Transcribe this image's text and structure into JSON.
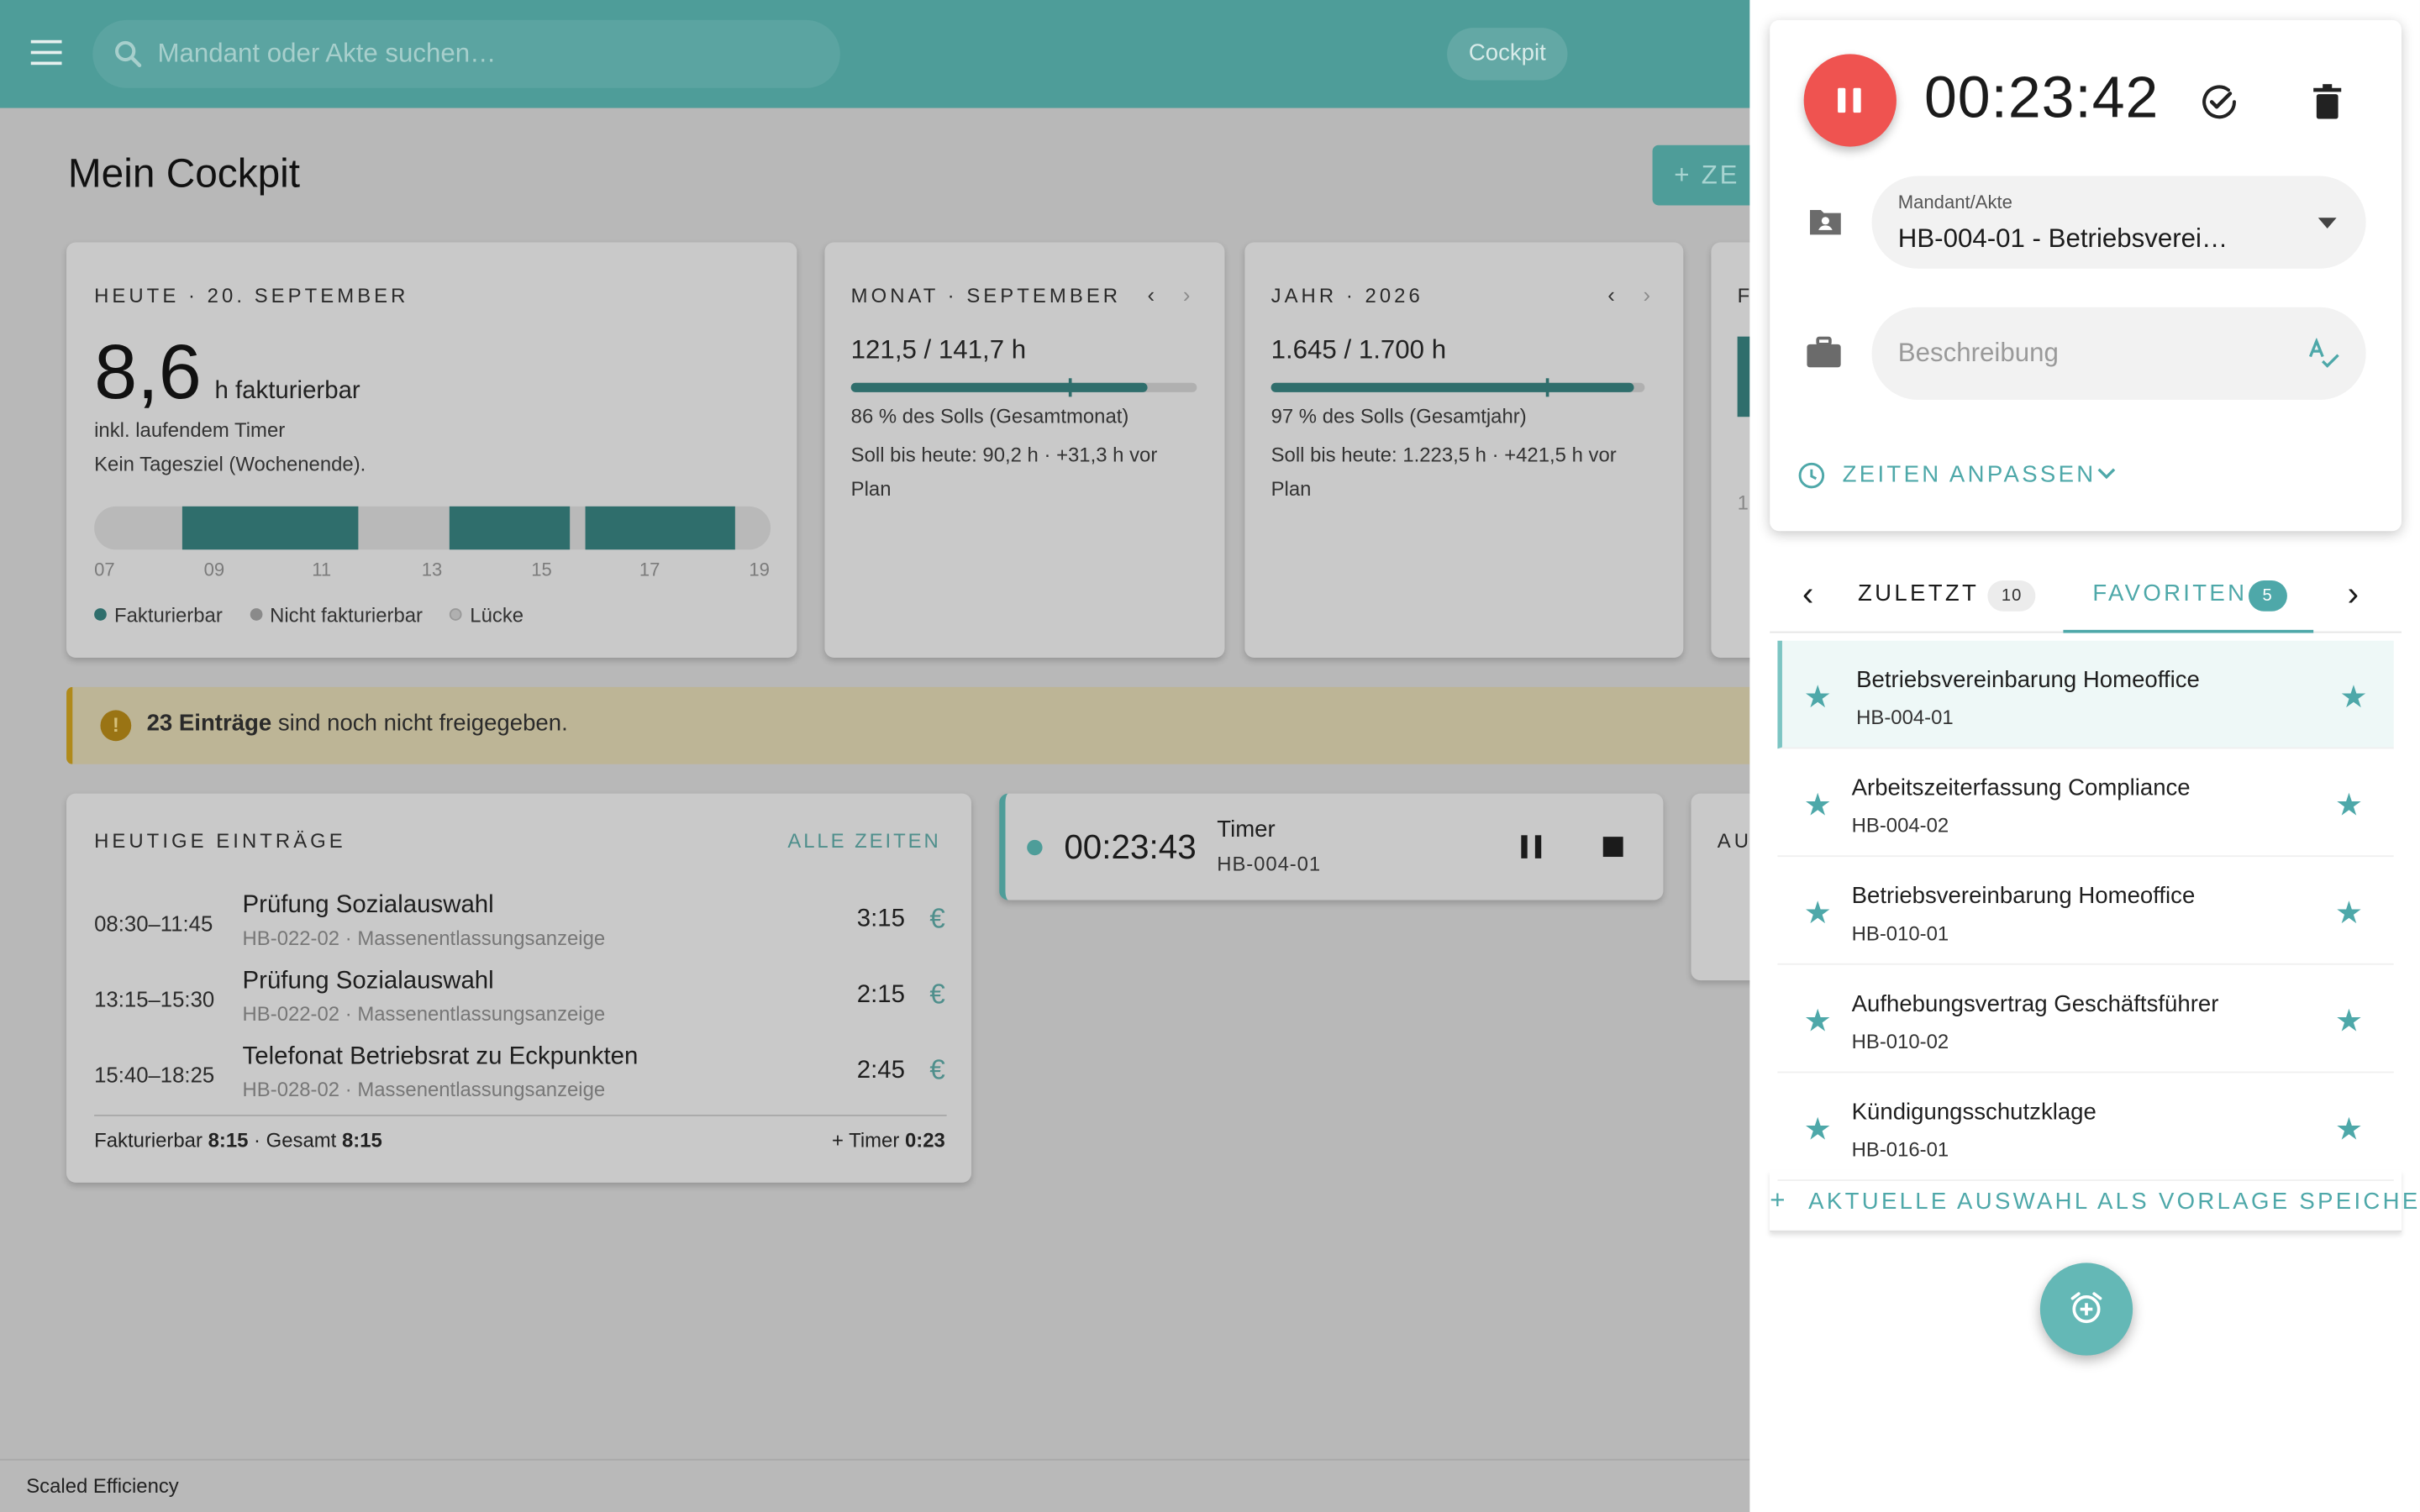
{
  "appbar": {
    "search_placeholder": "Mandant oder Akte suchen…",
    "chip": "Cockpit"
  },
  "page": {
    "title": "Mein Cockpit",
    "add_button": "+ ZE"
  },
  "today": {
    "overline": "HEUTE · 20. SEPTEMBER",
    "value": "8,6",
    "unit": "h fakturierbar",
    "note1": "inkl. laufendem Timer",
    "note2": "Kein Tagesziel (Wochenende).",
    "ticks": [
      "07",
      "09",
      "11",
      "13",
      "15",
      "17",
      "19"
    ],
    "legend": [
      "Fakturierbar",
      "Nicht fakturierbar",
      "Lücke"
    ]
  },
  "month": {
    "overline": "MONAT · SEPTEMBER",
    "value": "121,5 / 141,7 h",
    "percent": "86 % des Solls (Gesamtmonat)",
    "soll": "Soll bis heute: 90,2 h · +31,3 h vor Plan"
  },
  "year": {
    "overline": "JAHR · 2026",
    "value": "1.645 / 1.700 h",
    "percent": "97 % des Solls (Gesamtjahr)",
    "soll": "Soll bis heute: 1.223,5 h · +421,5 h vor Plan"
  },
  "clipped_card": {
    "overline_char": "F",
    "value_char": "1."
  },
  "banner": {
    "bold": "23 Einträge",
    "text": " sind noch nicht freigegeben."
  },
  "entries": {
    "overline": "HEUTIGE EINTRÄGE",
    "all_link": "ALLE ZEITEN",
    "rows": [
      {
        "time": "08:30–11:45",
        "title": "Prüfung Sozialauswahl",
        "sub": "HB-022-02 · Massenentlassungsanzeige",
        "dur": "3:15"
      },
      {
        "time": "13:15–15:30",
        "title": "Prüfung Sozialauswahl",
        "sub": "HB-022-02 · Massenentlassungsanzeige",
        "dur": "2:15"
      },
      {
        "time": "15:40–18:25",
        "title": "Telefonat Betriebsrat zu Eckpunkten",
        "sub": "HB-028-02 · Massenentlassungsanzeige",
        "dur": "2:45"
      }
    ],
    "footer_left_a": "Fakturierbar ",
    "footer_left_b": "8:15",
    "footer_left_c": " · Gesamt ",
    "footer_left_d": "8:15",
    "footer_right_a": "+ Timer ",
    "footer_right_b": "0:23"
  },
  "running": {
    "time": "00:23:43",
    "label": "Timer",
    "case": "HB-004-01"
  },
  "clipped_card2": {
    "overline": "AU"
  },
  "timer_panel": {
    "time": "00:23:42",
    "mandant_label": "Mandant/Akte",
    "mandant_value": "HB-004-01 - Betriebsverei…",
    "description_placeholder": "Beschreibung",
    "adjust": "ZEITEN ANPASSEN"
  },
  "tabs": {
    "recent": "ZULETZT",
    "recent_count": "10",
    "favorites": "FAVORITEN",
    "favorites_count": "5"
  },
  "favorites": [
    {
      "title": "Betriebsvereinbarung Homeoffice",
      "sub": "HB-004-01"
    },
    {
      "title": "Arbeitszeiterfassung Compliance",
      "sub": "HB-004-02"
    },
    {
      "title": "Betriebsvereinbarung Homeoffice",
      "sub": "HB-010-01"
    },
    {
      "title": "Aufhebungsvertrag Geschäftsführer",
      "sub": "HB-010-02"
    },
    {
      "title": "Kündigungsschutzklage",
      "sub": "HB-016-01"
    }
  ],
  "save_template": "AKTUELLE AUSWAHL ALS VORLAGE SPEICHERN",
  "footer": "Scaled Efficiency",
  "colors": {
    "primary": "#4e9d99",
    "accent": "#4ea8a9",
    "dark_teal": "#2f6e6c",
    "pause_red": "#ef5350",
    "warning": "#b08a1a"
  },
  "progress": {
    "month_fill": 0.86,
    "year_fill": 0.97
  }
}
